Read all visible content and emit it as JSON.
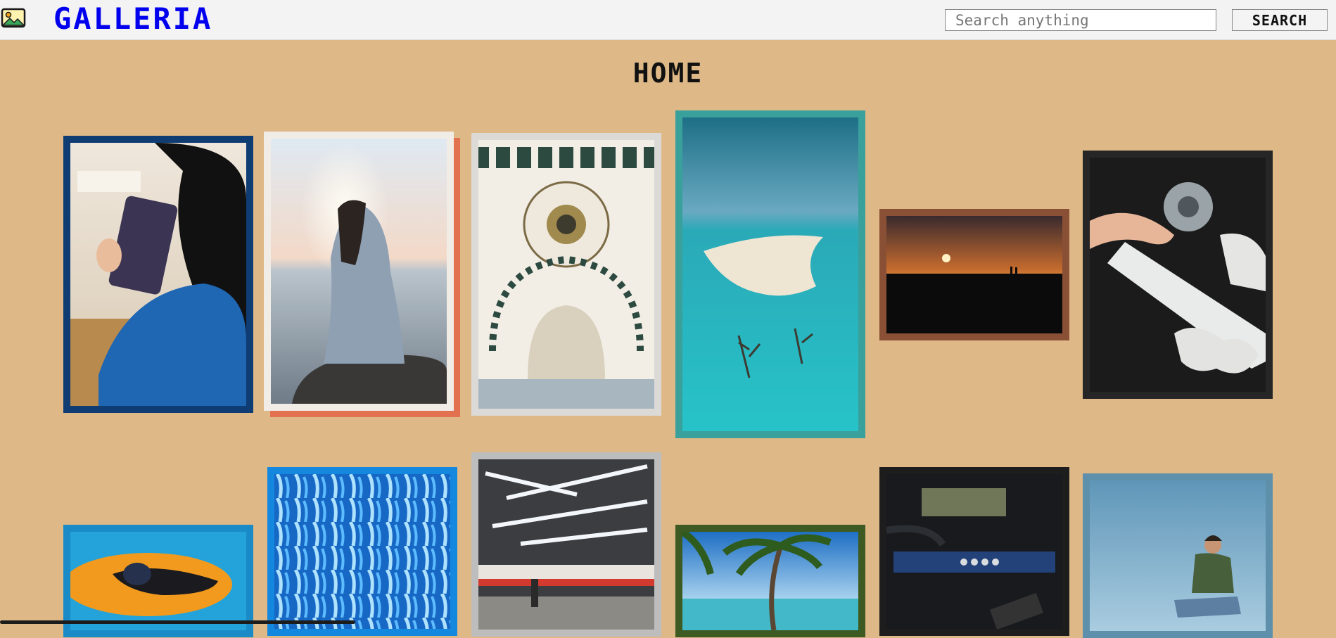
{
  "header": {
    "brand": "GALLERIA",
    "logo_icon": "image-icon",
    "search_placeholder": "Search anything",
    "search_value": "",
    "search_button": "SEARCH"
  },
  "main": {
    "title": "HOME"
  },
  "gallery": [
    {
      "subject": "tablet-reader",
      "frame_color": "#0e3c73"
    },
    {
      "subject": "woman-sunset-sea",
      "frame_color": "#f1ece6"
    },
    {
      "subject": "mosque-dome",
      "frame_color": "#dcdad7"
    },
    {
      "subject": "beach-sandbar",
      "frame_color": "#3aa09c"
    },
    {
      "subject": "sunset-silhouette",
      "frame_color": "#8a5036"
    },
    {
      "subject": "console-teardown",
      "frame_color": "#262626"
    },
    {
      "subject": "pool-float",
      "frame_color": "#1a8bc6"
    },
    {
      "subject": "blue-abstract",
      "frame_color": "#1487de"
    },
    {
      "subject": "subway-station",
      "frame_color": "#bdbdbd"
    },
    {
      "subject": "palm-beach",
      "frame_color": "#3d5a22"
    },
    {
      "subject": "circuit-board",
      "frame_color": "#1d1d1d"
    },
    {
      "subject": "man-sky",
      "frame_color": "#5e90ab"
    }
  ]
}
